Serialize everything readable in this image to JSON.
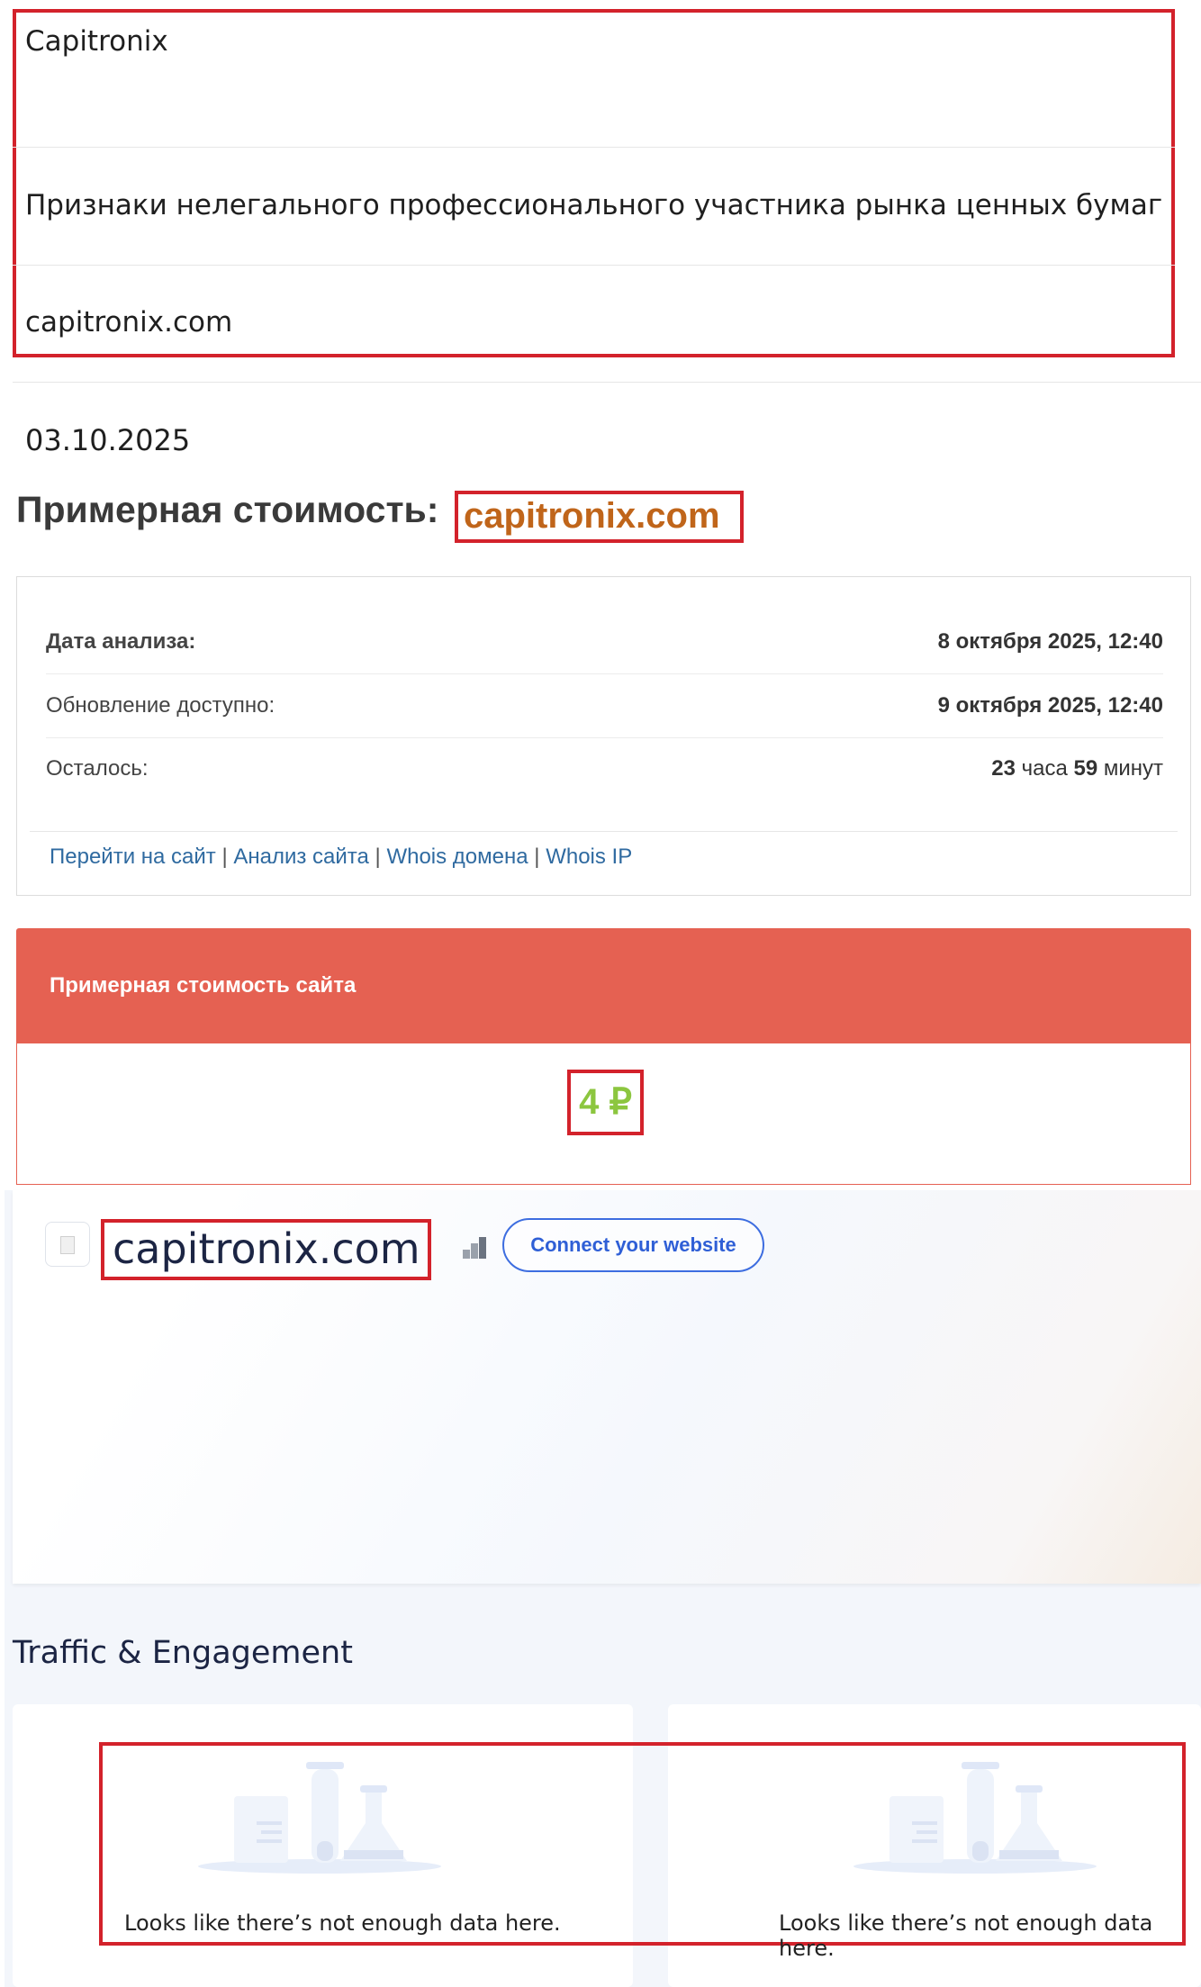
{
  "info": {
    "name": "Capitronix",
    "category": "Признаки нелегального профессионального участника рынка ценных бумаг",
    "domain": "capitronix.com"
  },
  "date": "03.10.2025",
  "cost": {
    "title": "Примерная стоимость:",
    "domain": "capitronix.com"
  },
  "panel": {
    "rows": [
      {
        "label": "Дата анализа:",
        "value": "8 октября 2025, 12:40"
      },
      {
        "label": "Обновление доступно:",
        "value": "9 октября 2025, 12:40"
      },
      {
        "label": "Осталось:",
        "value_hours": "23",
        "value_hours_word": "часа",
        "value_minutes": "59",
        "value_minutes_word": "минут"
      }
    ],
    "links": [
      "Перейти на сайт",
      "Анализ сайта",
      "Whois домена",
      "Whois IP"
    ],
    "separator": "|"
  },
  "price": {
    "header": "Примерная стоимость сайта",
    "value": "4 ₽"
  },
  "site": {
    "domain": "capitronix.com",
    "connect_label": "Connect your website"
  },
  "traffic": {
    "title": "Traffic & Engagement",
    "empty_message_1": "Looks like there’s not enough data here.",
    "empty_message_2": "Looks like there’s not enough data here."
  },
  "colors": {
    "highlight_border": "#d3222b",
    "cost_domain": "#c0651a",
    "price_header": "#e56152",
    "price_value": "#8cc63f",
    "link": "#2f6aa0",
    "connect_button": "#3d6de0"
  },
  "icons": [
    "file-icon",
    "rank-bars-icon",
    "lab-flasks-icon"
  ]
}
